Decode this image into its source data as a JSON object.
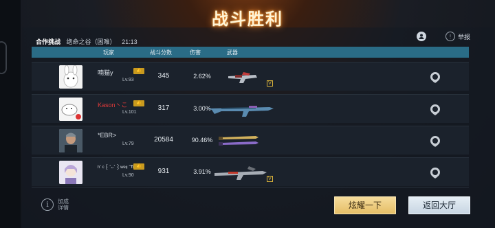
{
  "title": "战斗胜利",
  "mode": {
    "type": "合作挑战",
    "map": "绝命之谷（困难）",
    "time": "21:13"
  },
  "header": {
    "report_label": "举报"
  },
  "columns": {
    "player": "玩家",
    "score": "战斗分数",
    "damage": "伤害",
    "weapon": "武器"
  },
  "players": [
    {
      "name": "喃猫y",
      "level": "Lv.93",
      "score": "345",
      "damage": "2.62%",
      "weapon_badge": "V"
    },
    {
      "name": "Kason丶こ",
      "level": "Lv.101",
      "score": "317",
      "damage": "3.00%",
      "weapon_badge": ""
    },
    {
      "name": "*EBR>",
      "level": "Lv.79",
      "score": "20584",
      "damage": "90.46%",
      "weapon_badge": ""
    },
    {
      "name": "ʰ˙ᶜ꒰ˊᵕˋ꒱ʷᵉᵎᵎ ͡ ʰ",
      "level": "Lv.90",
      "score": "931",
      "damage": "3.91%",
      "weapon_badge": "V"
    }
  ],
  "footer": {
    "details_label_1": "加成",
    "details_label_2": "详情",
    "show_off": "炫耀一下",
    "back": "返回大厅"
  },
  "colors": {
    "header_bar": "#2a6c86",
    "gold_button": "#e5bd64",
    "name_red": "#e33a3a"
  }
}
